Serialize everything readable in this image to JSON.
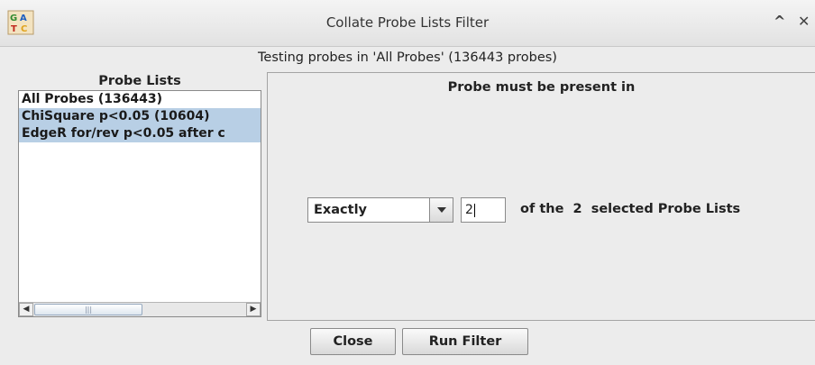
{
  "window": {
    "title": "Collate Probe Lists Filter",
    "app_icon": "seqmonk-app-icon",
    "controls": {
      "maximize": "^",
      "close": "✕"
    }
  },
  "subtitle": "Testing probes in 'All Probes' (136443 probes)",
  "probe_lists": {
    "header": "Probe Lists",
    "items": [
      {
        "label": "All Probes (136443)",
        "selected": false
      },
      {
        "label": "ChiSquare p<0.05 (10604)",
        "selected": true
      },
      {
        "label": "EdgeR for/rev p<0.05 after c",
        "selected": true
      }
    ],
    "scrollbar": {
      "left_arrow": "◀",
      "right_arrow": "▶",
      "thumb_grip": "|||"
    }
  },
  "options": {
    "heading": "Probe must be present in",
    "mode_selected": "Exactly",
    "count_value": "2",
    "suffix_text": "of the  2  selected Probe Lists"
  },
  "buttons": {
    "close_label": "Close",
    "run_label": "Run Filter"
  },
  "colors": {
    "selection": "#b8cfe5",
    "background": "#ececec"
  }
}
